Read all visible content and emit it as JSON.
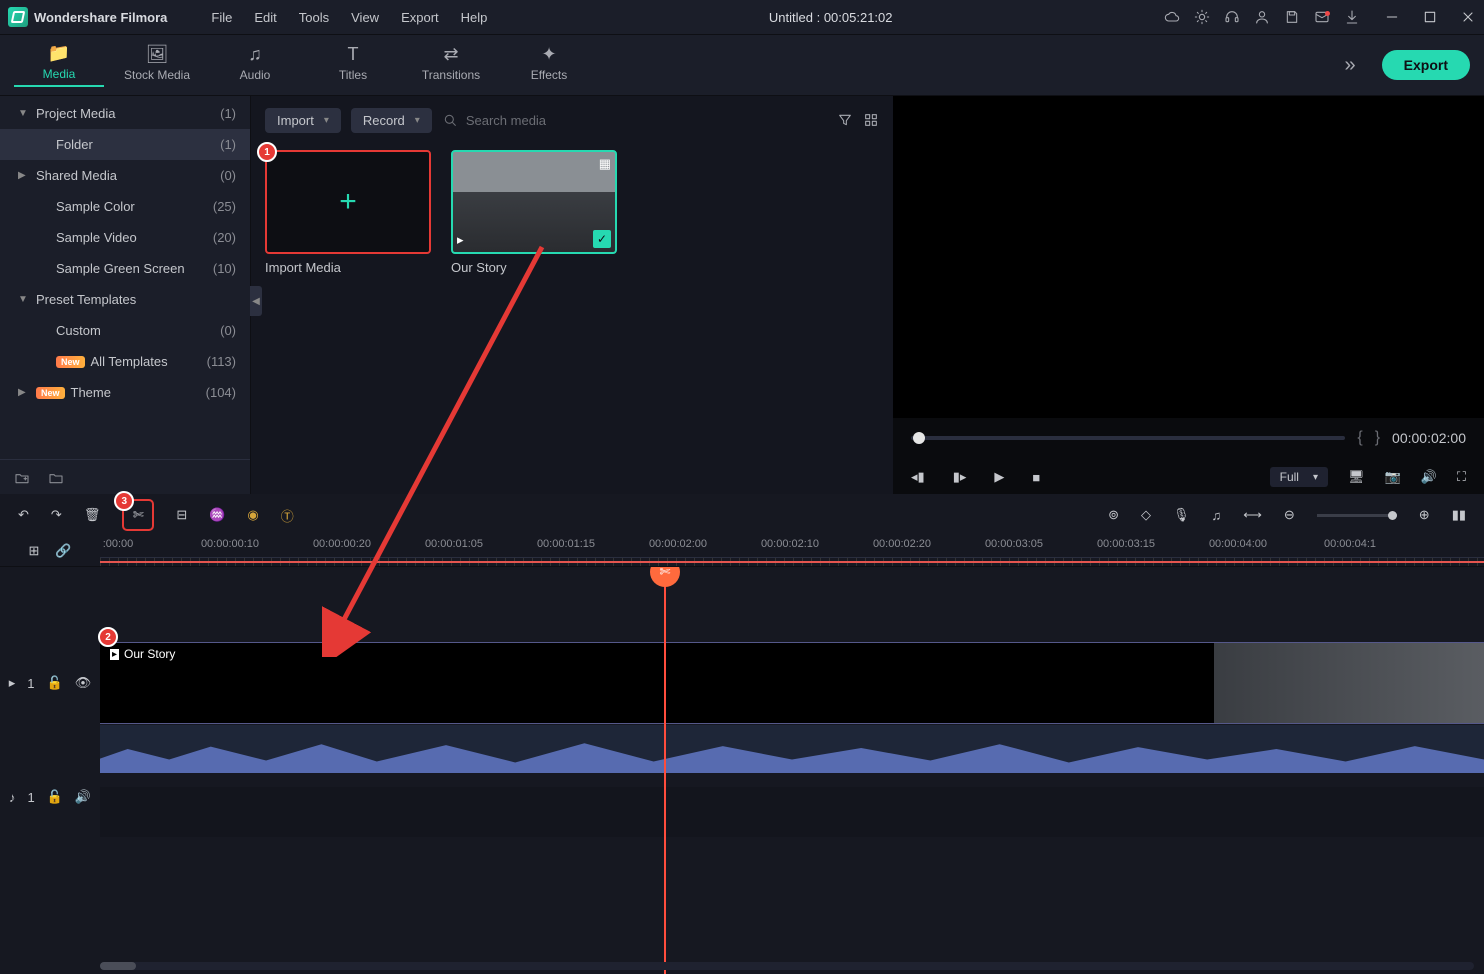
{
  "app": {
    "title": "Wondershare Filmora",
    "doc_title": "Untitled : 00:05:21:02"
  },
  "menu": [
    "File",
    "Edit",
    "Tools",
    "View",
    "Export",
    "Help"
  ],
  "tabs": [
    {
      "label": "Media",
      "active": true
    },
    {
      "label": "Stock Media"
    },
    {
      "label": "Audio"
    },
    {
      "label": "Titles"
    },
    {
      "label": "Transitions"
    },
    {
      "label": "Effects"
    }
  ],
  "export_label": "Export",
  "sidebar": {
    "items": [
      {
        "label": "Project Media",
        "count": "(1)",
        "arrow": "▼",
        "top": true
      },
      {
        "label": "Folder",
        "count": "(1)",
        "sel": true,
        "indent": true
      },
      {
        "label": "Shared Media",
        "count": "(0)",
        "arrow": "▶",
        "top": true
      },
      {
        "label": "Sample Color",
        "count": "(25)",
        "indent": true
      },
      {
        "label": "Sample Video",
        "count": "(20)",
        "indent": true
      },
      {
        "label": "Sample Green Screen",
        "count": "(10)",
        "indent": true
      },
      {
        "label": "Preset Templates",
        "count": "",
        "arrow": "▼",
        "top": true
      },
      {
        "label": "Custom",
        "count": "(0)",
        "indent": true
      },
      {
        "label": "All Templates",
        "count": "(113)",
        "new": true,
        "indent": true
      },
      {
        "label": "Theme",
        "count": "(104)",
        "arrow": "▶",
        "top": true,
        "new": true
      }
    ]
  },
  "browser": {
    "import_dd": "Import",
    "record_dd": "Record",
    "search_ph": "Search media",
    "thumbs": [
      {
        "label": "Import Media",
        "type": "import"
      },
      {
        "label": "Our Story",
        "type": "clip"
      }
    ]
  },
  "preview": {
    "timecode": "00:00:02:00",
    "quality": "Full"
  },
  "timeline": {
    "ticks": [
      ":00:00",
      "00:00:00:10",
      "00:00:00:20",
      "00:00:01:05",
      "00:00:01:15",
      "00:00:02:00",
      "00:00:02:10",
      "00:00:02:20",
      "00:00:03:05",
      "00:00:03:15",
      "00:00:04:00",
      "00:00:04:1"
    ],
    "clip_label": "Our Story",
    "video_track_label": "1",
    "audio_track_label": "1"
  }
}
